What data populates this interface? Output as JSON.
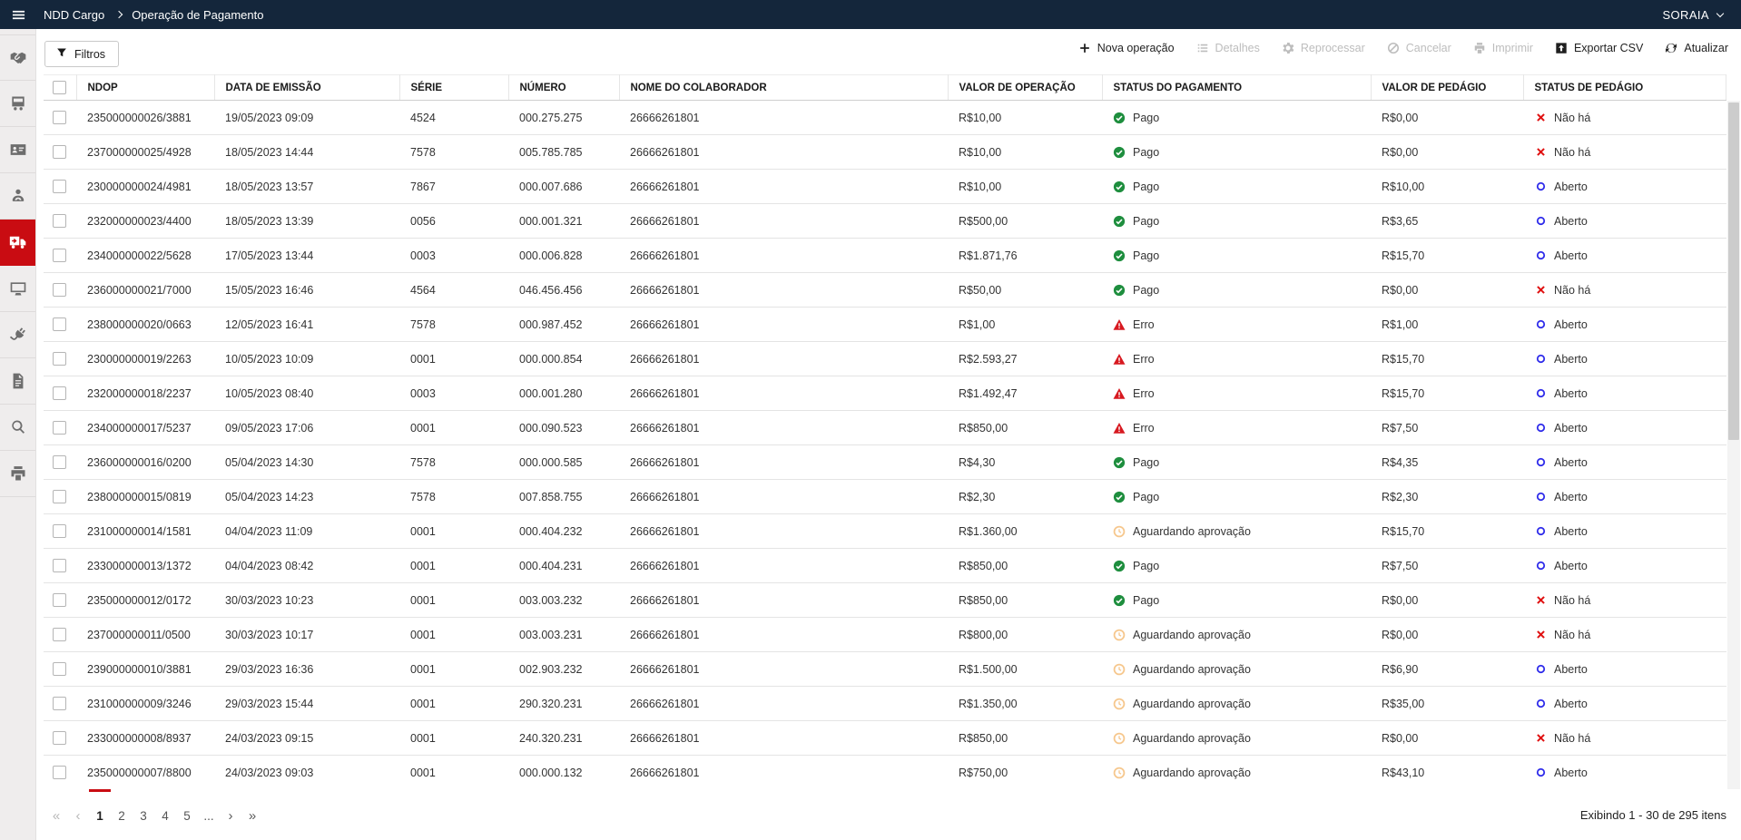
{
  "colors": {
    "topbar_navy": "#14263b",
    "brand_red": "#c90c12",
    "status_paid_green": "#1e8e3e",
    "status_error_red": "#d71920",
    "status_waiting_orange": "#f6c78d",
    "status_open_blue": "#2e2bea",
    "status_none_red": "#e01212"
  },
  "header": {
    "brand": "NDD Cargo",
    "page_title": "Operação de Pagamento",
    "user": "SORAIA"
  },
  "sidebar": {
    "items": [
      {
        "icon": "handshake",
        "active": false
      },
      {
        "icon": "truck-front",
        "active": false
      },
      {
        "icon": "id-card",
        "active": false
      },
      {
        "icon": "driver",
        "active": false
      },
      {
        "icon": "delivery-truck",
        "active": true
      },
      {
        "icon": "monitor",
        "active": false
      },
      {
        "icon": "plug",
        "active": false
      },
      {
        "icon": "document",
        "active": false
      },
      {
        "icon": "search",
        "active": false
      },
      {
        "icon": "printer",
        "active": false
      }
    ]
  },
  "toolbar": {
    "filters_label": "Filtros",
    "actions": [
      {
        "name": "nova-operacao",
        "label": "Nova operação",
        "icon": "plus",
        "enabled": true
      },
      {
        "name": "detalhes",
        "label": "Detalhes",
        "icon": "list",
        "enabled": false
      },
      {
        "name": "reprocessar",
        "label": "Reprocessar",
        "icon": "gears",
        "enabled": false
      },
      {
        "name": "cancelar",
        "label": "Cancelar",
        "icon": "cancel",
        "enabled": false
      },
      {
        "name": "imprimir",
        "label": "Imprimir",
        "icon": "printer-small",
        "enabled": false
      },
      {
        "name": "exportar-csv",
        "label": "Exportar CSV",
        "icon": "export",
        "enabled": true
      },
      {
        "name": "atualizar",
        "label": "Atualizar",
        "icon": "refresh",
        "enabled": true
      }
    ]
  },
  "table": {
    "columns": [
      "NDOP",
      "DATA DE EMISSÃO",
      "SÉRIE",
      "NÚMERO",
      "NOME DO COLABORADOR",
      "VALOR DE OPERAÇÃO",
      "STATUS DO PAGAMENTO",
      "VALOR DE PEDÁGIO",
      "STATUS DE PEDÁGIO"
    ],
    "rows": [
      {
        "ndop": "235000000026/3881",
        "data_emissao": "19/05/2023 09:09",
        "serie": "4524",
        "numero": "000.275.275",
        "colaborador": "26666261801",
        "valor_operacao": "R$10,00",
        "status_pagamento": "Pago",
        "valor_pedagio": "R$0,00",
        "status_pedagio": "Não há"
      },
      {
        "ndop": "237000000025/4928",
        "data_emissao": "18/05/2023 14:44",
        "serie": "7578",
        "numero": "005.785.785",
        "colaborador": "26666261801",
        "valor_operacao": "R$10,00",
        "status_pagamento": "Pago",
        "valor_pedagio": "R$0,00",
        "status_pedagio": "Não há"
      },
      {
        "ndop": "230000000024/4981",
        "data_emissao": "18/05/2023 13:57",
        "serie": "7867",
        "numero": "000.007.686",
        "colaborador": "26666261801",
        "valor_operacao": "R$10,00",
        "status_pagamento": "Pago",
        "valor_pedagio": "R$10,00",
        "status_pedagio": "Aberto"
      },
      {
        "ndop": "232000000023/4400",
        "data_emissao": "18/05/2023 13:39",
        "serie": "0056",
        "numero": "000.001.321",
        "colaborador": "26666261801",
        "valor_operacao": "R$500,00",
        "status_pagamento": "Pago",
        "valor_pedagio": "R$3,65",
        "status_pedagio": "Aberto"
      },
      {
        "ndop": "234000000022/5628",
        "data_emissao": "17/05/2023 13:44",
        "serie": "0003",
        "numero": "000.006.828",
        "colaborador": "26666261801",
        "valor_operacao": "R$1.871,76",
        "status_pagamento": "Pago",
        "valor_pedagio": "R$15,70",
        "status_pedagio": "Aberto"
      },
      {
        "ndop": "236000000021/7000",
        "data_emissao": "15/05/2023 16:46",
        "serie": "4564",
        "numero": "046.456.456",
        "colaborador": "26666261801",
        "valor_operacao": "R$50,00",
        "status_pagamento": "Pago",
        "valor_pedagio": "R$0,00",
        "status_pedagio": "Não há"
      },
      {
        "ndop": "238000000020/0663",
        "data_emissao": "12/05/2023 16:41",
        "serie": "7578",
        "numero": "000.987.452",
        "colaborador": "26666261801",
        "valor_operacao": "R$1,00",
        "status_pagamento": "Erro",
        "valor_pedagio": "R$1,00",
        "status_pedagio": "Aberto"
      },
      {
        "ndop": "230000000019/2263",
        "data_emissao": "10/05/2023 10:09",
        "serie": "0001",
        "numero": "000.000.854",
        "colaborador": "26666261801",
        "valor_operacao": "R$2.593,27",
        "status_pagamento": "Erro",
        "valor_pedagio": "R$15,70",
        "status_pedagio": "Aberto"
      },
      {
        "ndop": "232000000018/2237",
        "data_emissao": "10/05/2023 08:40",
        "serie": "0003",
        "numero": "000.001.280",
        "colaborador": "26666261801",
        "valor_operacao": "R$1.492,47",
        "status_pagamento": "Erro",
        "valor_pedagio": "R$15,70",
        "status_pedagio": "Aberto"
      },
      {
        "ndop": "234000000017/5237",
        "data_emissao": "09/05/2023 17:06",
        "serie": "0001",
        "numero": "000.090.523",
        "colaborador": "26666261801",
        "valor_operacao": "R$850,00",
        "status_pagamento": "Erro",
        "valor_pedagio": "R$7,50",
        "status_pedagio": "Aberto"
      },
      {
        "ndop": "236000000016/0200",
        "data_emissao": "05/04/2023 14:30",
        "serie": "7578",
        "numero": "000.000.585",
        "colaborador": "26666261801",
        "valor_operacao": "R$4,30",
        "status_pagamento": "Pago",
        "valor_pedagio": "R$4,35",
        "status_pedagio": "Aberto"
      },
      {
        "ndop": "238000000015/0819",
        "data_emissao": "05/04/2023 14:23",
        "serie": "7578",
        "numero": "007.858.755",
        "colaborador": "26666261801",
        "valor_operacao": "R$2,30",
        "status_pagamento": "Pago",
        "valor_pedagio": "R$2,30",
        "status_pedagio": "Aberto"
      },
      {
        "ndop": "231000000014/1581",
        "data_emissao": "04/04/2023 11:09",
        "serie": "0001",
        "numero": "000.404.232",
        "colaborador": "26666261801",
        "valor_operacao": "R$1.360,00",
        "status_pagamento": "Aguardando aprovação",
        "valor_pedagio": "R$15,70",
        "status_pedagio": "Aberto"
      },
      {
        "ndop": "233000000013/1372",
        "data_emissao": "04/04/2023 08:42",
        "serie": "0001",
        "numero": "000.404.231",
        "colaborador": "26666261801",
        "valor_operacao": "R$850,00",
        "status_pagamento": "Pago",
        "valor_pedagio": "R$7,50",
        "status_pedagio": "Aberto"
      },
      {
        "ndop": "235000000012/0172",
        "data_emissao": "30/03/2023 10:23",
        "serie": "0001",
        "numero": "003.003.232",
        "colaborador": "26666261801",
        "valor_operacao": "R$850,00",
        "status_pagamento": "Pago",
        "valor_pedagio": "R$0,00",
        "status_pedagio": "Não há"
      },
      {
        "ndop": "237000000011/0500",
        "data_emissao": "30/03/2023 10:17",
        "serie": "0001",
        "numero": "003.003.231",
        "colaborador": "26666261801",
        "valor_operacao": "R$800,00",
        "status_pagamento": "Aguardando aprovação",
        "valor_pedagio": "R$0,00",
        "status_pedagio": "Não há"
      },
      {
        "ndop": "239000000010/3881",
        "data_emissao": "29/03/2023 16:36",
        "serie": "0001",
        "numero": "002.903.232",
        "colaborador": "26666261801",
        "valor_operacao": "R$1.500,00",
        "status_pagamento": "Aguardando aprovação",
        "valor_pedagio": "R$6,90",
        "status_pedagio": "Aberto"
      },
      {
        "ndop": "231000000009/3246",
        "data_emissao": "29/03/2023 15:44",
        "serie": "0001",
        "numero": "290.320.231",
        "colaborador": "26666261801",
        "valor_operacao": "R$1.350,00",
        "status_pagamento": "Aguardando aprovação",
        "valor_pedagio": "R$35,00",
        "status_pedagio": "Aberto"
      },
      {
        "ndop": "233000000008/8937",
        "data_emissao": "24/03/2023 09:15",
        "serie": "0001",
        "numero": "240.320.231",
        "colaborador": "26666261801",
        "valor_operacao": "R$850,00",
        "status_pagamento": "Aguardando aprovação",
        "valor_pedagio": "R$0,00",
        "status_pedagio": "Não há"
      },
      {
        "ndop": "235000000007/8800",
        "data_emissao": "24/03/2023 09:03",
        "serie": "0001",
        "numero": "000.000.132",
        "colaborador": "26666261801",
        "valor_operacao": "R$750,00",
        "status_pagamento": "Aguardando aprovação",
        "valor_pedagio": "R$43,10",
        "status_pedagio": "Aberto"
      }
    ]
  },
  "pagination": {
    "first": "«",
    "prev": "‹",
    "pages": [
      "1",
      "2",
      "3",
      "4",
      "5"
    ],
    "ellipsis": "...",
    "next": "›",
    "last": "»",
    "active_page": "1",
    "summary": "Exibindo 1 - 30 de 295 itens"
  }
}
